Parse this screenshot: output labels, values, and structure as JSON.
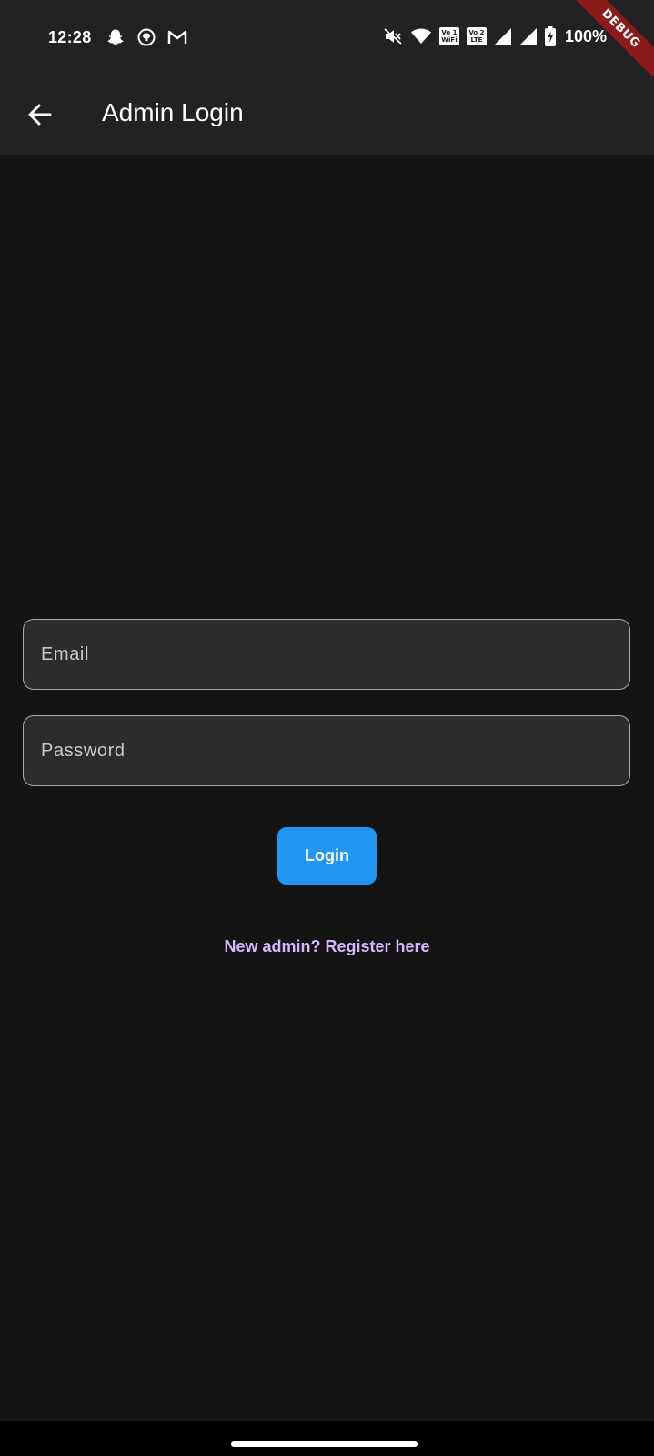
{
  "status_bar": {
    "time": "12:28",
    "left_icons": [
      "snapchat-icon",
      "github-icon",
      "gmail-icon"
    ],
    "right_icons": [
      "mute-icon",
      "wifi-icon",
      "vowifi-icon",
      "volte-icon",
      "signal-1-icon",
      "signal-2-icon",
      "battery-charging-icon"
    ],
    "vowifi_badge": {
      "top": "Vo 1",
      "bottom": "WiFi"
    },
    "volte_badge": {
      "top": "Vo 2",
      "bottom": "LTE"
    },
    "battery": "100%"
  },
  "debug_banner": "DEBUG",
  "app_bar": {
    "title": "Admin Login",
    "back_icon": "arrow-back-icon"
  },
  "form": {
    "email_placeholder": "Email",
    "email_value": "",
    "password_placeholder": "Password",
    "password_value": "",
    "login_label": "Login",
    "register_link": "New admin? Register here"
  },
  "colors": {
    "background": "#141414",
    "app_bar": "#222222",
    "field_fill": "#2c2c2d",
    "field_border": "#a9a9a9",
    "primary": "#2196f3",
    "link": "#d6b6ff",
    "debug": "#8b1a1a"
  }
}
